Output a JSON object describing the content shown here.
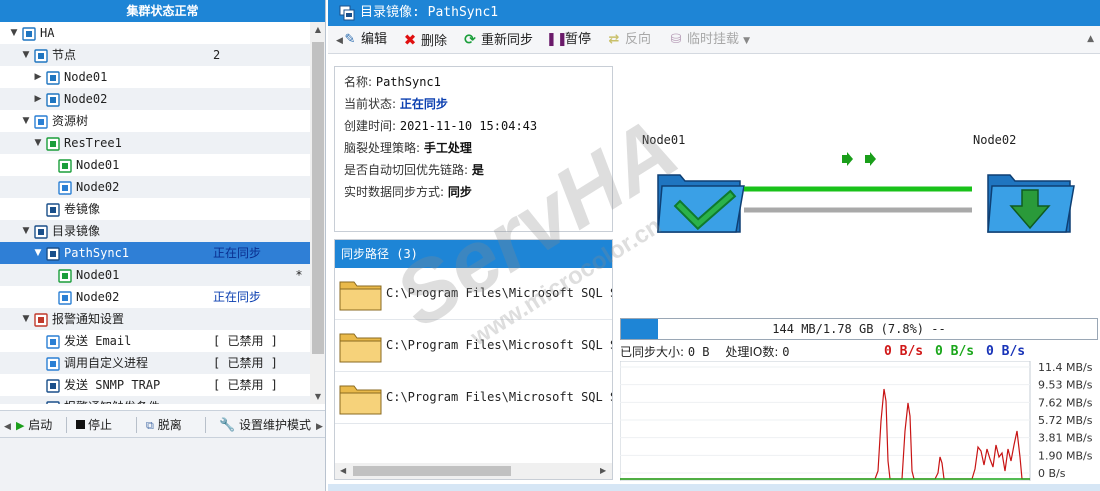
{
  "left_panel": {
    "title": "集群状态正常",
    "tree": [
      {
        "label": "HA",
        "col2": "",
        "col3": "",
        "icon": "cluster-icon",
        "expander": "down"
      },
      {
        "label": "节点",
        "col2": "2",
        "col3": "",
        "icon": "nodes-group-icon",
        "expander": "down"
      },
      {
        "label": "Node01",
        "col2": "",
        "col3": "",
        "icon": "server-icon",
        "expander": "right"
      },
      {
        "label": "Node02",
        "col2": "",
        "col3": "",
        "icon": "server-icon",
        "expander": "right"
      },
      {
        "label": "资源树",
        "col2": "",
        "col3": "",
        "icon": "resource-tree-icon",
        "expander": "down"
      },
      {
        "label": "ResTree1",
        "col2": "",
        "col3": "",
        "icon": "restree-icon",
        "expander": "down"
      },
      {
        "label": "Node01",
        "col2": "",
        "col3": "",
        "icon": "node-active-icon",
        "expander": ""
      },
      {
        "label": "Node02",
        "col2": "",
        "col3": "",
        "icon": "node-standby-icon",
        "expander": ""
      },
      {
        "label": "卷镜像",
        "col2": "",
        "col3": "",
        "icon": "volume-mirror-icon",
        "expander": ""
      },
      {
        "label": "目录镜像",
        "col2": "",
        "col3": "",
        "icon": "dir-mirror-icon",
        "expander": "down"
      },
      {
        "label": "PathSync1",
        "col2": "正在同步",
        "col3": "",
        "icon": "pathsync-icon",
        "expander": "down"
      },
      {
        "label": "Node01",
        "col2": "",
        "col3": "*",
        "icon": "node-source-icon",
        "expander": ""
      },
      {
        "label": "Node02",
        "col2": "正在同步",
        "col3": "",
        "icon": "node-target-icon",
        "expander": ""
      },
      {
        "label": "报警通知设置",
        "col2": "",
        "col3": "",
        "icon": "alarm-icon",
        "expander": "down"
      },
      {
        "label": "发送 Email",
        "col2": "[ 已禁用 ]",
        "col3": "",
        "icon": "email-icon",
        "expander": ""
      },
      {
        "label": "调用自定义进程",
        "col2": "[ 已禁用 ]",
        "col3": "",
        "icon": "process-icon",
        "expander": ""
      },
      {
        "label": "发送 SNMP TRAP",
        "col2": "[ 已禁用 ]",
        "col3": "",
        "icon": "snmp-icon",
        "expander": ""
      },
      {
        "label": "报警通知触发条件",
        "col2": "",
        "col3": "",
        "icon": "trigger-icon",
        "expander": ""
      }
    ],
    "toolbar": {
      "start": "启动",
      "stop": "停止",
      "detach": "脱离",
      "maintenance": "设置维护模式"
    }
  },
  "right_panel": {
    "title": "目录镜像: PathSync1",
    "toolbar": {
      "edit": "编辑",
      "delete": "删除",
      "resync": "重新同步",
      "pause": "暂停",
      "reverse": "反向",
      "temp_mount": "临时挂载"
    },
    "info": {
      "name_label": "名称: ",
      "name_value": "PathSync1",
      "state_label": "当前状态: ",
      "state_value": "正在同步",
      "created_label": "创建时间: ",
      "created_value": "2021-11-10 15:04:43",
      "splitbrain_label": "脑裂处理策略: ",
      "splitbrain_value": "手工处理",
      "autoswitch_label": "是否自动切回优先链路: ",
      "autoswitch_value": "是",
      "syncmode_label": "实时数据同步方式: ",
      "syncmode_value": "同步"
    },
    "paths": {
      "header": "同步路径 (3)",
      "items": [
        "C:\\Program Files\\Microsoft SQL Serv",
        "C:\\Program Files\\Microsoft SQL Serv",
        "C:\\Program Files\\Microsoft SQL Serv"
      ]
    },
    "diagram": {
      "source_label": "Node01",
      "target_label": "Node02"
    },
    "progress": {
      "text": "144 MB/1.78 GB (7.8%) --",
      "fraction": 0.078
    },
    "stats": {
      "synced_label": "已同步大小: ",
      "synced_value": "0 B",
      "io_label": "处理IO数: ",
      "io_value": "0",
      "rate_red": "0 B/s",
      "rate_green": "0 B/s",
      "rate_blue": "0 B/s"
    },
    "graph": {
      "y_labels": [
        "11.4 MB/s",
        "9.53 MB/s",
        "7.62 MB/s",
        "5.72 MB/s",
        "3.81 MB/s",
        "1.90 MB/s",
        "0 B/s"
      ]
    }
  },
  "watermark": {
    "brand": "ServHA",
    "site": "www.microcolor.cn"
  },
  "colors": {
    "title_blue": "#1e85d6",
    "selected_row": "#2f7fd6",
    "sync_green": "#19c21a",
    "idle_gray": "#a9a9a9",
    "red_rate": "#d01818",
    "green_rate": "#1aa61a",
    "blue_rate": "#1833b8"
  }
}
